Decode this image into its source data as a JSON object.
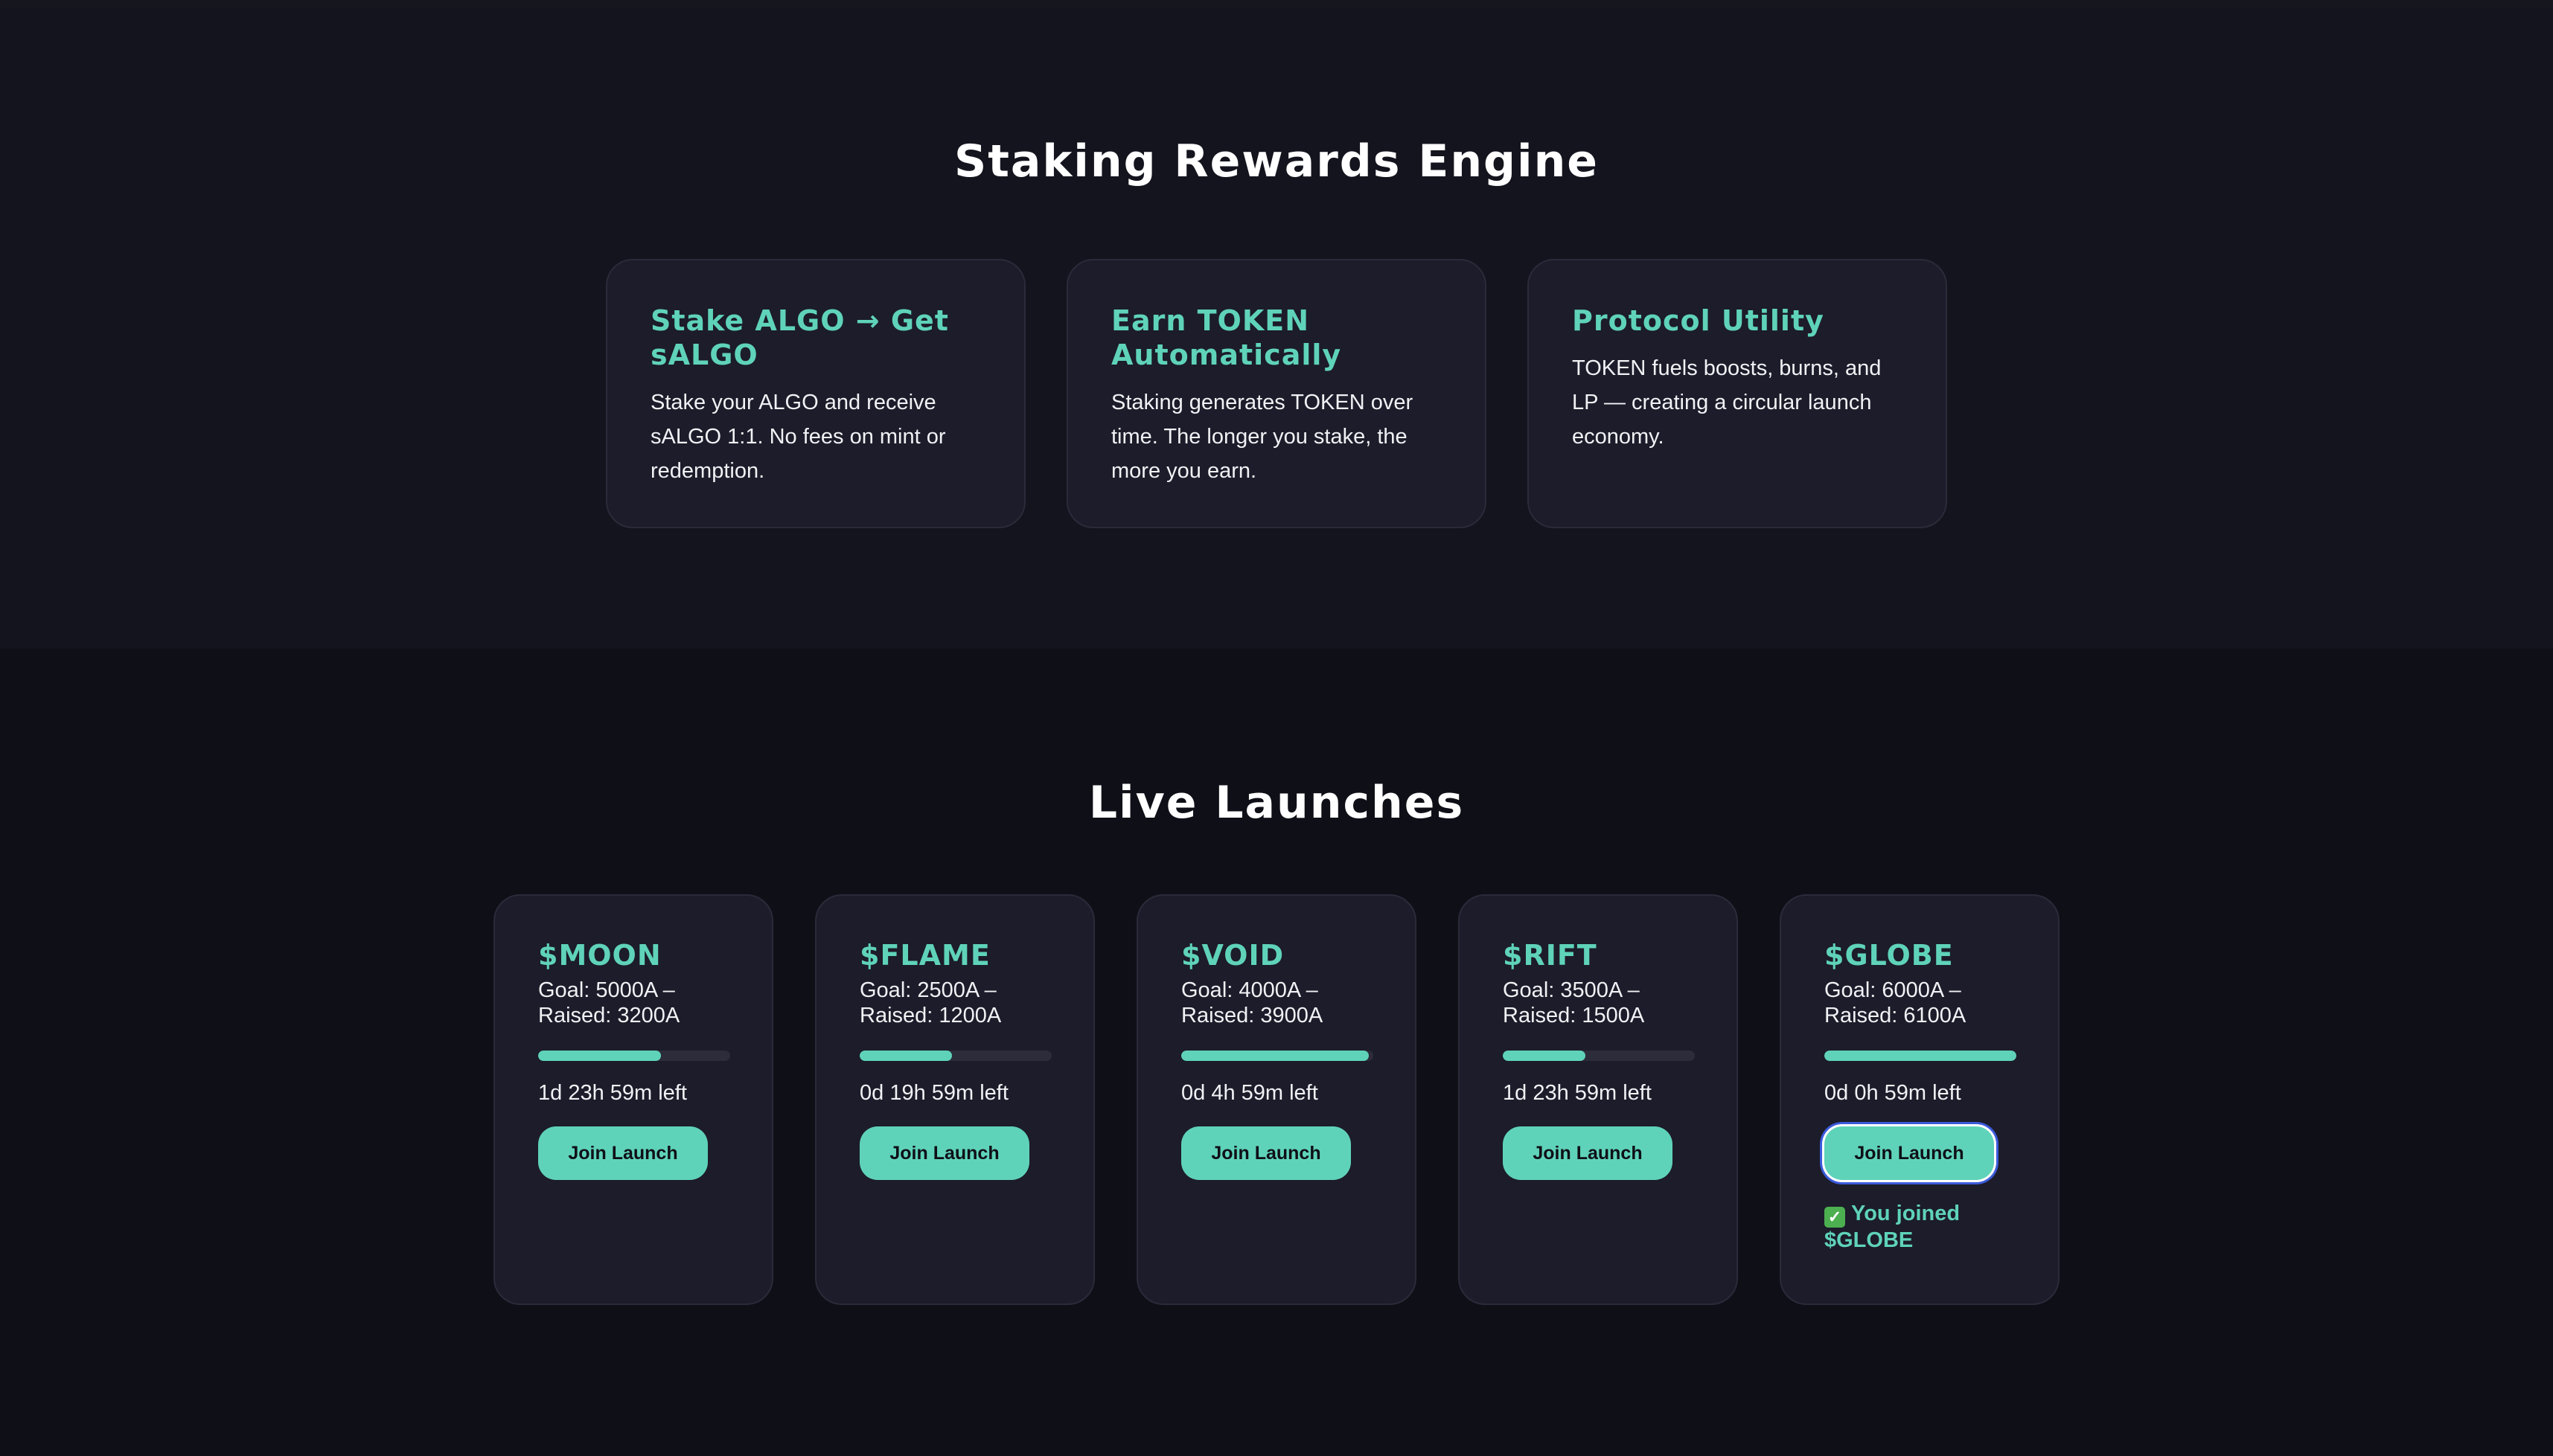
{
  "staking": {
    "title": "Staking Rewards Engine",
    "cards": [
      {
        "title": "Stake ALGO → Get sALGO",
        "text": "Stake your ALGO and receive sALGO 1:1. No fees on mint or redemption."
      },
      {
        "title": "Earn TOKEN Automatically",
        "text": "Staking generates TOKEN over time. The longer you stake, the more you earn."
      },
      {
        "title": "Protocol Utility",
        "text": "TOKEN fuels boosts, burns, and LP — creating a circular launch economy."
      }
    ]
  },
  "launches": {
    "title": "Live Launches",
    "items": [
      {
        "ticker": "$MOON",
        "goal_line1": "Goal: 5000A –",
        "goal_line2": "Raised: 3200A",
        "progress": 0.64,
        "time_left": "1d 23h 59m left",
        "button": "Join Launch"
      },
      {
        "ticker": "$FLAME",
        "goal_line1": "Goal: 2500A –",
        "goal_line2": "Raised: 1200A",
        "progress": 0.48,
        "time_left": "0d 19h 59m left",
        "button": "Join Launch"
      },
      {
        "ticker": "$VOID",
        "goal_line1": "Goal: 4000A –",
        "goal_line2": "Raised: 3900A",
        "progress": 0.975,
        "time_left": "0d 4h 59m left",
        "button": "Join Launch"
      },
      {
        "ticker": "$RIFT",
        "goal_line1": "Goal: 3500A –",
        "goal_line2": "Raised: 1500A",
        "progress": 0.43,
        "time_left": "1d 23h 59m left",
        "button": "Join Launch"
      },
      {
        "ticker": "$GLOBE",
        "goal_line1": "Goal: 6000A –",
        "goal_line2": "Raised: 6100A",
        "progress": 1.0,
        "time_left": "0d 0h 59m left",
        "button": "Join Launch",
        "joined_message": "You joined $GLOBE"
      }
    ]
  },
  "colors": {
    "accent": "#5fd3b9",
    "background": "#0f0f17",
    "card": "#1c1c2a"
  }
}
